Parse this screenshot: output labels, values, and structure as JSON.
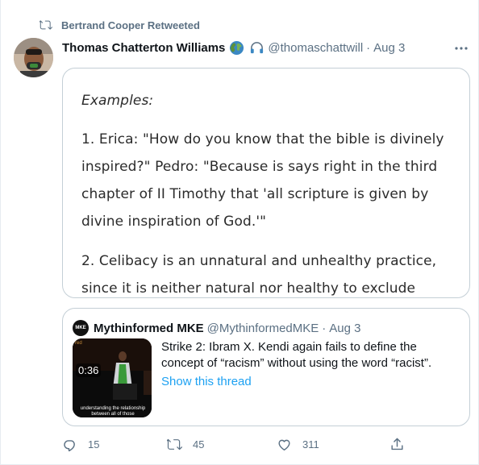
{
  "retweet": {
    "text": "Bertrand Cooper Retweeted"
  },
  "tweet": {
    "author_name": "Thomas Chatterton Williams",
    "handle": "@thomaschattwill",
    "separator": "·",
    "date": "Aug 3",
    "image_text": {
      "heading": "Examples:",
      "lines": [
        "1. Erica: \"How do you know that the bible is divinely",
        "inspired?\" Pedro: \"Because is says right in the third",
        "chapter of II Timothy that 'all scripture is given by",
        "divine inspiration of God.'\"",
        "2. Celibacy is an unnatural and unhealthy practice,",
        "since it is neither natural nor healthy to exclude"
      ]
    }
  },
  "quoted": {
    "avatar_text": "MKE",
    "name": "Mythinformed MKE",
    "handle": "@MythinformedMKE",
    "separator": "·",
    "date": "Aug 3",
    "text": "Strike 2: Ibram X. Kendi again fails to define the concept of “racism” without using the word “racist”.",
    "show_thread": "Show this thread",
    "video_duration": "0:36",
    "video_caption": "understanding the relationship between all of those",
    "video_corner_text": "red"
  },
  "actions": {
    "replies": "15",
    "retweets": "45",
    "likes": "311"
  },
  "colors": {
    "secondary": "#5b7083",
    "link": "#1da1f2",
    "border": "#c4cfd6"
  }
}
